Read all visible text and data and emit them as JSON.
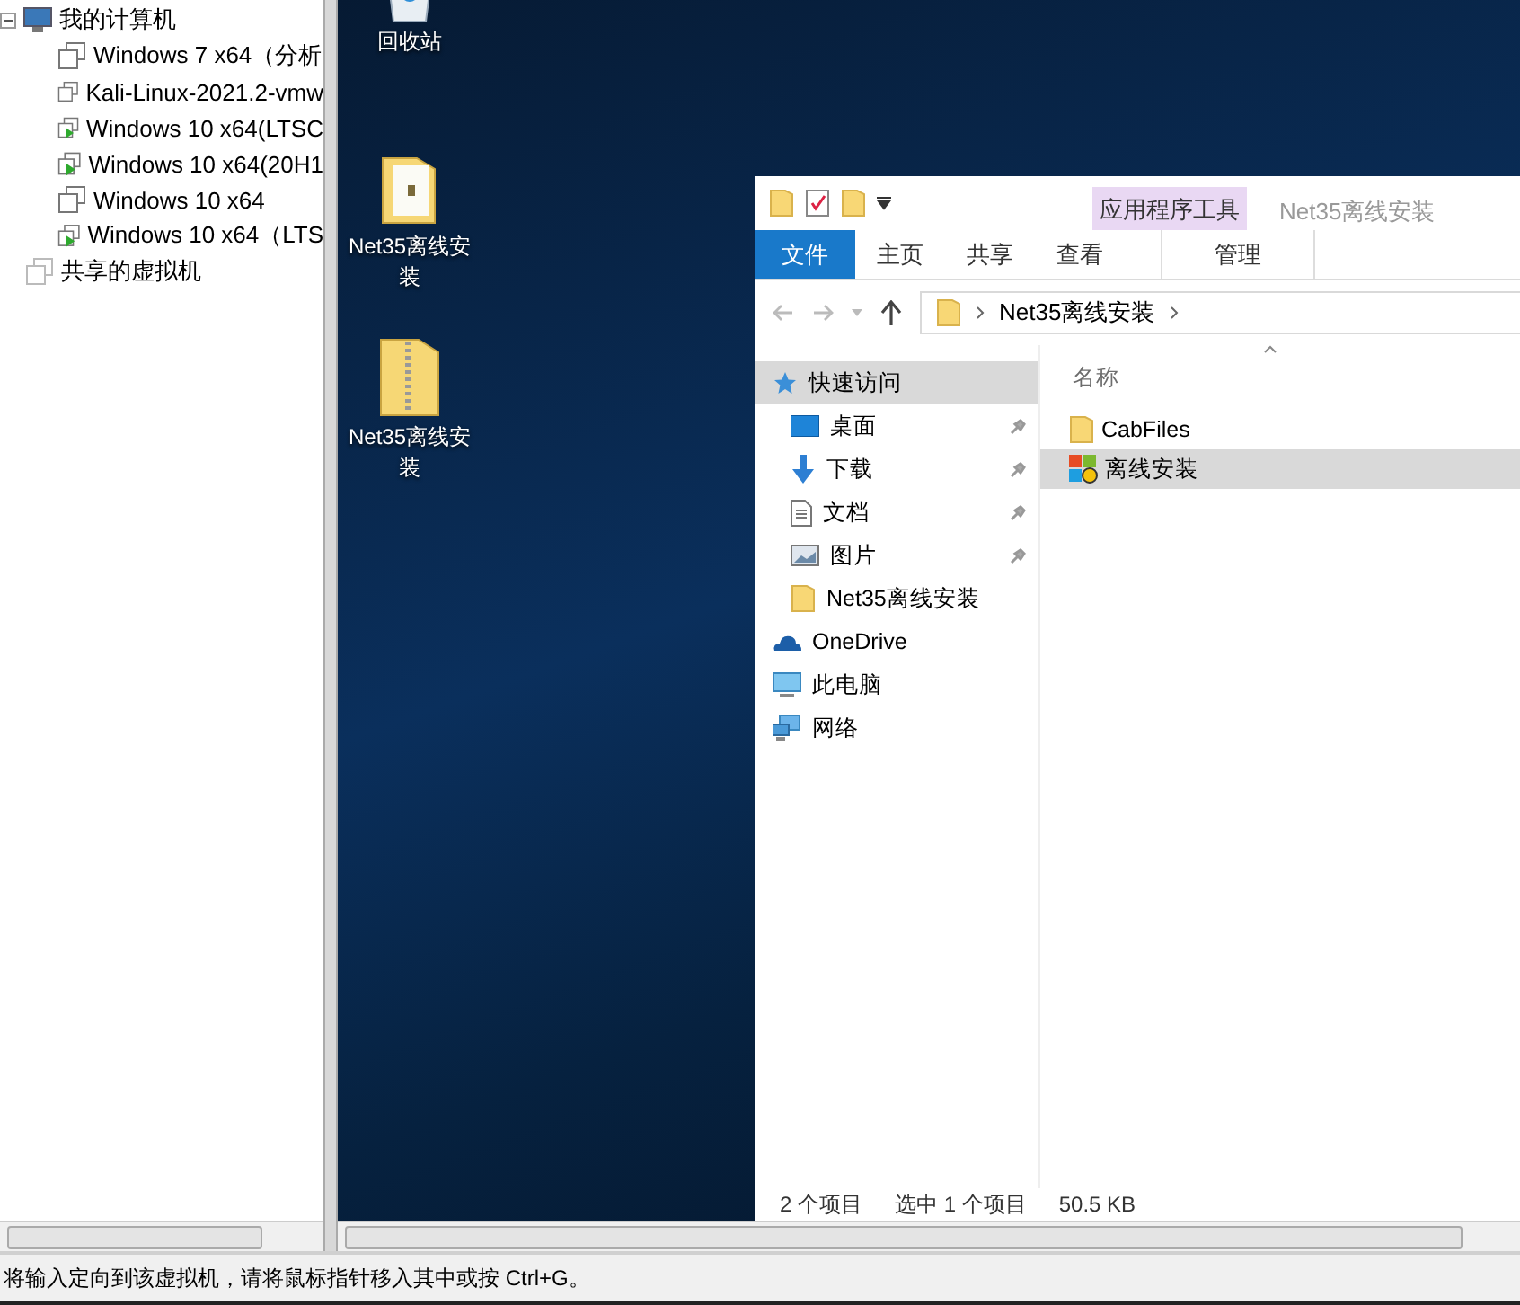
{
  "library": {
    "root": {
      "label": "我的计算机",
      "expanded": true,
      "children": [
        {
          "label": "Windows 7 x64（分析",
          "running": false
        },
        {
          "label": "Kali-Linux-2021.2-vmw",
          "running": false
        },
        {
          "label": "Windows 10 x64(LTSC",
          "running": true
        },
        {
          "label": "Windows 10 x64(20H1",
          "running": true
        },
        {
          "label": "Windows 10 x64",
          "running": false
        },
        {
          "label": "Windows 10 x64（LTS",
          "running": true
        }
      ]
    },
    "shared": {
      "label": "共享的虚拟机"
    }
  },
  "desktop": {
    "icons": [
      {
        "label": "回收站",
        "kind": "recycle"
      },
      {
        "label": "Net35离线安装",
        "kind": "folder"
      },
      {
        "label": "Net35离线安装",
        "kind": "zip"
      }
    ]
  },
  "explorer": {
    "context_tab": "应用程序工具",
    "title": "Net35离线安装",
    "tabs": [
      {
        "label": "文件",
        "kind": "file",
        "selected": false
      },
      {
        "label": "主页",
        "kind": "tab",
        "selected": false
      },
      {
        "label": "共享",
        "kind": "tab",
        "selected": false
      },
      {
        "label": "查看",
        "kind": "tab",
        "selected": false
      },
      {
        "label": "管理",
        "kind": "context",
        "selected": false
      }
    ],
    "address": [
      "Net35离线安装"
    ],
    "nav": [
      {
        "label": "快速访问",
        "kind": "star",
        "selected": true,
        "pinned": false,
        "children": [
          {
            "label": "桌面",
            "kind": "desktop",
            "selected": false,
            "pinned": true
          },
          {
            "label": "下载",
            "kind": "download",
            "selected": false,
            "pinned": true
          },
          {
            "label": "文档",
            "kind": "document",
            "selected": false,
            "pinned": true
          },
          {
            "label": "图片",
            "kind": "picture",
            "selected": false,
            "pinned": true
          },
          {
            "label": "Net35离线安装",
            "kind": "folder",
            "selected": false,
            "pinned": false
          }
        ]
      },
      {
        "label": "OneDrive",
        "kind": "cloud",
        "selected": false,
        "pinned": false
      },
      {
        "label": "此电脑",
        "kind": "pc",
        "selected": false,
        "pinned": false
      },
      {
        "label": "网络",
        "kind": "network",
        "selected": false,
        "pinned": false
      }
    ],
    "column": "名称",
    "files": [
      {
        "name": "CabFiles",
        "kind": "folder",
        "selected": false
      },
      {
        "name": "离线安装",
        "kind": "app",
        "selected": true
      }
    ],
    "status": [
      "2 个项目",
      "选中 1 个项目",
      "50.5 KB"
    ]
  },
  "status_bar": "将输入定向到该虚拟机，请将鼠标指针移入其中或按 Ctrl+G。"
}
